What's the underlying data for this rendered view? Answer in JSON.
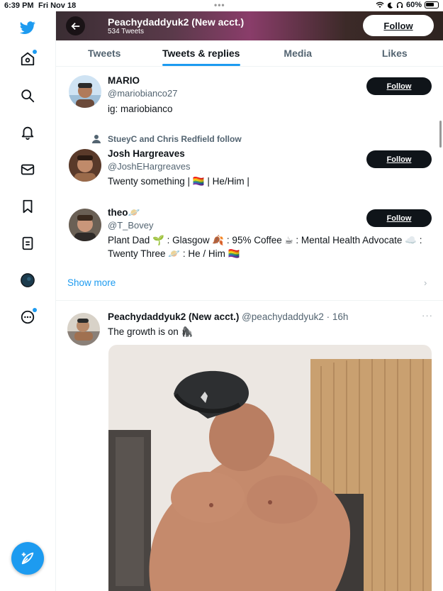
{
  "statusbar": {
    "time": "6:39 PM",
    "date": "Fri Nov 18",
    "dots": "•••",
    "battery": "60%"
  },
  "nav": {
    "items": [
      {
        "icon": "twitter-logo-icon"
      },
      {
        "icon": "home-icon",
        "badge": true
      },
      {
        "icon": "search-icon"
      },
      {
        "icon": "notifications-icon"
      },
      {
        "icon": "messages-icon"
      },
      {
        "icon": "bookmarks-icon"
      },
      {
        "icon": "lists-icon"
      },
      {
        "icon": "profile-avatar"
      },
      {
        "icon": "more-icon",
        "badge": true
      }
    ],
    "compose": "compose-tweet-icon"
  },
  "header": {
    "name": "Peachydaddyuk2 (New acct.)",
    "tweet_count": "534 Tweets",
    "follow_label": "Follow"
  },
  "tabs": [
    "Tweets",
    "Tweets & replies",
    "Media",
    "Likes"
  ],
  "active_tab": "Tweets & replies",
  "suggestions": [
    {
      "name": "MARIO",
      "handle": "@mariobianco27",
      "bio": "ig: mariobianco",
      "follow_label": "Follow"
    },
    {
      "social_context": "StueyC and Chris Redfield follow",
      "name": "Josh Hargreaves",
      "handle": "@JoshEHargreaves",
      "bio": "Twenty something | 🏳️‍🌈 | He/Him |",
      "follow_label": "Follow"
    },
    {
      "name": "theo🪐",
      "handle": "@T_Bovey",
      "bio": "Plant Dad 🌱 : Glasgow 🍂 : 95% Coffee ☕ : Mental Health Advocate ☁️ : Twenty Three 🪐 : He / Him 🏳️‍🌈",
      "follow_label": "Follow"
    }
  ],
  "show_more": "Show more",
  "tweet": {
    "name": "Peachydaddyuk2 (New acct.)",
    "handle": "@peachydaddyuk2",
    "time": "· 16h",
    "text": "The growth is on 🦍",
    "more": "···"
  },
  "colors": {
    "accent": "#1d9bf0",
    "text": "#0f1419",
    "secondary": "#536471"
  }
}
